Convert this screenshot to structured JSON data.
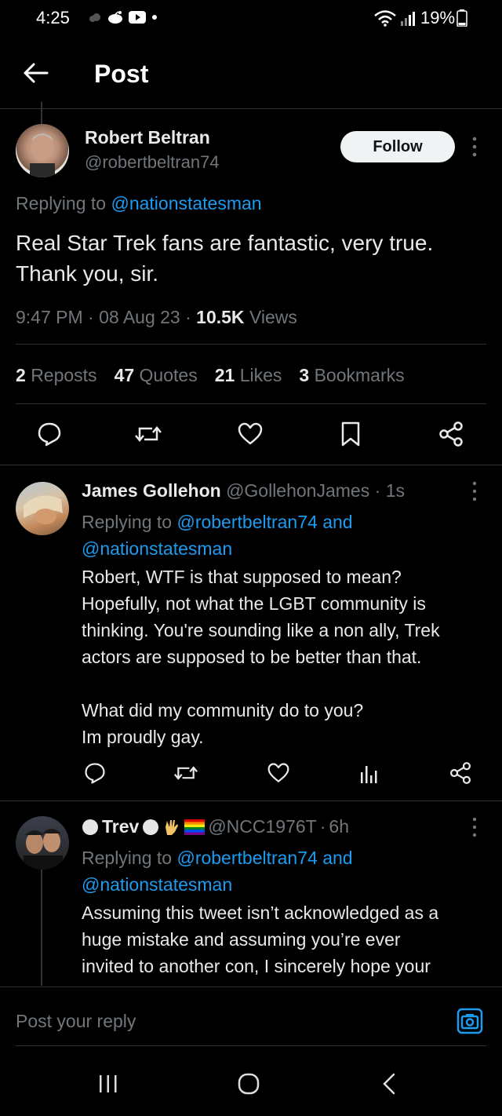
{
  "status_bar": {
    "time": "4:25",
    "battery": "19%"
  },
  "header": {
    "title": "Post"
  },
  "main_post": {
    "author_name": "Robert Beltran",
    "author_handle": "@robertbeltran74",
    "follow_label": "Follow",
    "replying_prefix": "Replying to",
    "replying_to": "@nationstatesman",
    "text_line1": "Real Star Trek fans are fantastic, very true.",
    "text_line2": "Thank you, sir.",
    "time": "9:47 PM",
    "date": "08 Aug 23",
    "views_count": "10.5K",
    "views_label": "Views",
    "stats": [
      {
        "count": "2",
        "label": "Reposts"
      },
      {
        "count": "47",
        "label": "Quotes"
      },
      {
        "count": "21",
        "label": "Likes"
      },
      {
        "count": "3",
        "label": "Bookmarks"
      }
    ]
  },
  "replies": [
    {
      "author_name": "James Gollehon",
      "author_handle": "@GollehonJames",
      "age": "1s",
      "replying_prefix": "Replying to",
      "replying_to_1": "@robertbeltran74",
      "replying_and": "and",
      "replying_to_2": "@nationstatesman",
      "lines": [
        "Robert, WTF is that supposed to mean?",
        "Hopefully, not what the LGBT community is",
        "thinking. You're sounding like a non ally, Trek",
        "actors are supposed to be better than that.",
        "",
        "What did my community do to you?",
        "Im proudly gay."
      ]
    },
    {
      "author_name": "Trev",
      "author_handle": "@NCC1976T",
      "age": "6h",
      "replying_prefix": "Replying to",
      "replying_to_1": "@robertbeltran74",
      "replying_and": "and",
      "replying_to_2": "@nationstatesman",
      "lines": [
        "Assuming this tweet isn’t acknowledged as a",
        "huge mistake and assuming you’re ever",
        "invited to another con, I sincerely hope your"
      ]
    }
  ],
  "reply_box": {
    "placeholder": "Post your reply"
  },
  "colors": {
    "background": "#000000",
    "text": "#e7e9ea",
    "muted": "#71767b",
    "link": "#1d9bf0",
    "divider": "#2f3336"
  }
}
